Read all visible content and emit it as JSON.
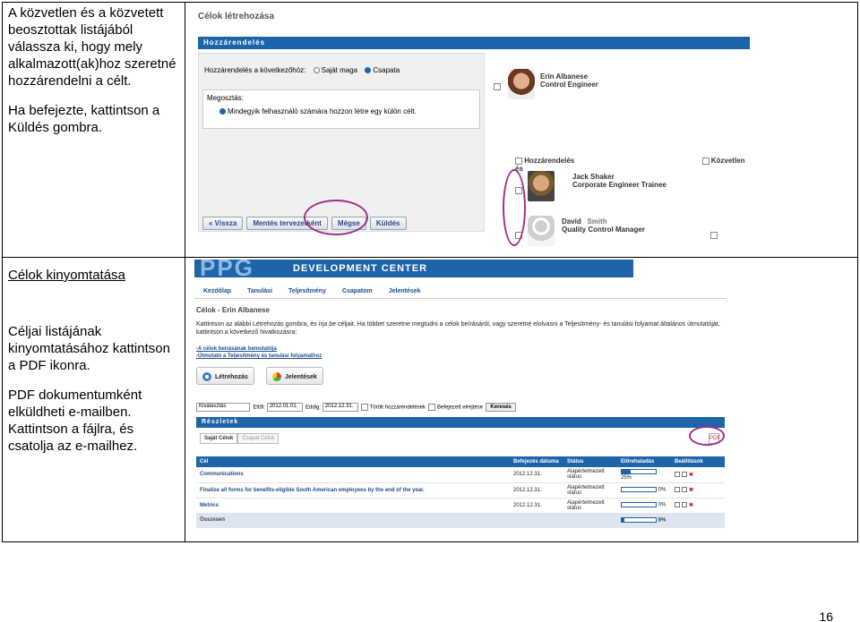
{
  "row1": {
    "instructions": [
      "A közvetlen és a közvetett beosztottak listájából válassza ki, hogy mely alkalmazott(ak)hoz szeretné hozzárendelni a célt.",
      "Ha befejezte, kattintson a Küldés gombra."
    ],
    "screenshot": {
      "title": "Célok létrehozása",
      "section": "Hozzárendelés",
      "assign_label": "Hozzárendelés a következőhöz:",
      "option_self": "Saját maga",
      "option_team": "Csapata",
      "share_label": "Megosztás:",
      "share_option": "Mindegyik felhasználó számára hozzon létre egy külön célt.",
      "buttons": [
        "« Vissza",
        "Mentés tervezetként",
        "Mégse",
        "Küldés"
      ],
      "col_assign": "Hozzárendelés",
      "col_direct": "Közvetlen és",
      "users": [
        {
          "name": "Erin Albanese",
          "title": "Control Engineer"
        },
        {
          "name": "Jack Shaker",
          "title": "Corporate Engineer Trainee"
        },
        {
          "name": "David",
          "name2": "Smith",
          "title": "Quality Control Manager"
        }
      ]
    }
  },
  "row2": {
    "heading": "Célok kinyomtatása",
    "instructions": [
      "Céljai listájának kinyomtatásához kattintson a PDF ikonra.",
      "PDF dokumentumként elküldheti e-mailben. Kattintson a fájlra, és csatolja az e-mailhez."
    ],
    "screenshot": {
      "logo": "PPG",
      "banner": "DEVELOPMENT CENTER",
      "nav": [
        "Kezdőlap",
        "Tanulási",
        "Teljesítmény",
        "Csapatom",
        "Jelentések"
      ],
      "page_title": "Célok - Erin Albanese",
      "intro": "Kattintson az alábbi Létrehozás gombra, és írja be céljait. Ha többet szeretne megtudni a célok beírásáról, vagy szeretné elolvasni a Teljesítmény- és tanulási folyamat általános útmutatóját, kattintson a következő hivatkozásra:",
      "links": [
        "-A célok beírásának bemutatója",
        "-Útmutató a Teljesítmény és tanulási folyamathoz"
      ],
      "btn_create": "Létrehozás",
      "btn_reports": "Jelentések",
      "filter_select": "Kiválasztás",
      "from_label": "Ettől:",
      "from_value": "2012.01.01.",
      "to_label": "Eddig:",
      "to_value": "2012.12.31.",
      "deleted_label": "Törölt hozzárendelések",
      "completed_label": "Befejezett elrejtése",
      "search_btn": "Keresés",
      "details": "Részletek",
      "tabs": [
        "Saját Célok",
        "Csapat Célok"
      ],
      "pdf": "PDF",
      "columns": [
        "Cél",
        "Befejezés dátuma",
        "Státus",
        "Előrehaladás",
        "Beállítások"
      ],
      "rows": [
        {
          "goal": "Communications",
          "date": "2012.12.31.",
          "status": "Alapértelmezett státus",
          "progress": 25,
          "progress_label": "25%"
        },
        {
          "goal": "Finalize all forms for benefits-eligible South American employees by the end of the year.",
          "date": "2012.12.31.",
          "status": "Alapértelmezett státus",
          "progress": 0,
          "progress_label": "0%"
        },
        {
          "goal": "Metrics",
          "date": "2012.12.31.",
          "status": "Alapértelmezett státus",
          "progress": 0,
          "progress_label": "0%"
        }
      ],
      "summary": {
        "label": "Összesen",
        "progress": 8,
        "progress_label": "8%"
      }
    }
  },
  "page_number": "16"
}
